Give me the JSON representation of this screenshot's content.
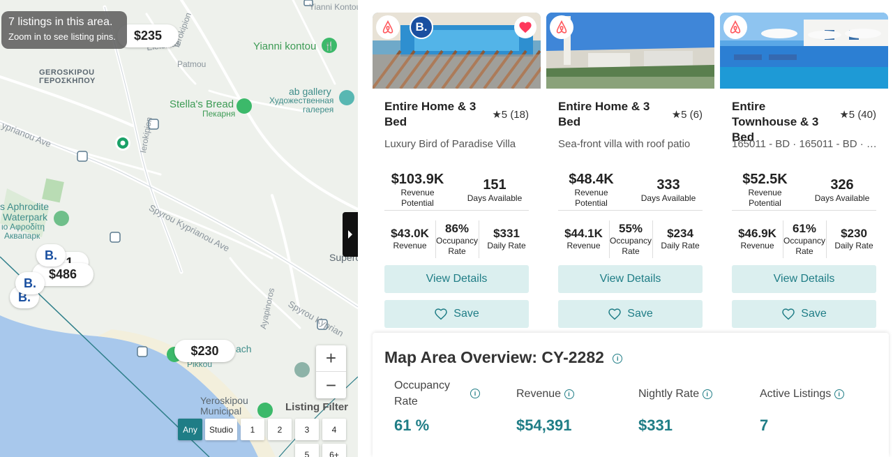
{
  "map": {
    "banner": {
      "line1": "7 listings in this area.",
      "line2": "Zoom in to see listing pins."
    },
    "labels": {
      "yianni_konto_top": "Yianni Kontou",
      "yianni_kontou": "Yianni kontou",
      "geroskipou_1": "GEROSKIPOU",
      "geroskipou_2": "ΓΕΡΟΣΚΗΠΟΥ",
      "elefsinas": "Elefsinas",
      "patmou": "Patmou",
      "ierokipion_1": "Ierokipion",
      "ierokipion_2": "Ierokipion",
      "stellas_bread_1": "Stella's Bread",
      "stellas_bread_2": "Пекарня",
      "ab_gallery_1": "ab gallery",
      "ab_gallery_2": "Художественная",
      "ab_gallery_3": "галерея",
      "kyprianou_ave": "yprianou Ave",
      "aphrodite_1": "s Aphrodite",
      "aphrodite_2": "Waterpark",
      "aphrodite_3": "ιο Αφροδίτη",
      "aphrodite_4": "Аквапарк",
      "spyrou_1": "Spyrou Kyprianou Ave",
      "spyrou_2": "Spyrou Kyprian",
      "supercos": "Supercos",
      "ayapinoros": "Ayapinoros",
      "beach": "ach",
      "pikkou": "Pikkou",
      "yeroskipou_mun_1": "Yeroskipou",
      "yeroskipou_mun_2": "Municipal"
    },
    "price_pins": {
      "pin1": "$235",
      "pin2": "$486",
      "pin3": "$230",
      "pin4": "1"
    },
    "booking_pin_label": "B.",
    "zoom": {
      "plus": "+",
      "minus": "−"
    },
    "filter": {
      "title": "Listing Filter",
      "options": [
        "Any",
        "Studio",
        "1",
        "2",
        "3",
        "4",
        "5",
        "6+"
      ],
      "selected": "Any"
    }
  },
  "listings": [
    {
      "title": "Entire Home & 3 Bed",
      "rating": "★5 (18)",
      "subtitle": "Luxury Bird of Paradise Villa",
      "revenue_potential": "$103.9K",
      "revenue_potential_label": "Revenue Potential",
      "days_available": "151",
      "days_available_label": "Days Available",
      "revenue": "$43.0K",
      "revenue_label": "Revenue",
      "occupancy": "86%",
      "occupancy_label": "Occupancy Rate",
      "daily_rate": "$331",
      "daily_rate_label": "Daily Rate",
      "view_label": "View Details",
      "save_label": "Save",
      "favorited": true,
      "platforms": [
        "airbnb-logo",
        "booking-logo"
      ]
    },
    {
      "title": "Entire Home & 3 Bed",
      "rating": "★5 (6)",
      "subtitle": "Sea-front villa with roof patio",
      "revenue_potential": "$48.4K",
      "revenue_potential_label": "Revenue Potential",
      "days_available": "333",
      "days_available_label": "Days Available",
      "revenue": "$44.1K",
      "revenue_label": "Revenue",
      "occupancy": "55%",
      "occupancy_label": "Occupancy Rate",
      "daily_rate": "$234",
      "daily_rate_label": "Daily Rate",
      "view_label": "View Details",
      "save_label": "Save",
      "favorited": false,
      "platforms": [
        "airbnb-logo"
      ]
    },
    {
      "title": "Entire Townhouse & 3 Bed",
      "rating": "★5 (40)",
      "subtitle": "165011 - BD · 165011 - BD · …",
      "revenue_potential": "$52.5K",
      "revenue_potential_label": "Revenue Potential",
      "days_available": "326",
      "days_available_label": "Days Available",
      "revenue": "$46.9K",
      "revenue_label": "Revenue",
      "occupancy": "61%",
      "occupancy_label": "Occupancy Rate",
      "daily_rate": "$230",
      "daily_rate_label": "Daily Rate",
      "view_label": "View Details",
      "save_label": "Save",
      "favorited": false,
      "platforms": [
        "airbnb-logo"
      ]
    }
  ],
  "overview": {
    "title": "Map Area Overview: CY-2282",
    "metrics": [
      {
        "label": "Occupancy Rate",
        "value": "61 %"
      },
      {
        "label": "Revenue",
        "value": "$54,391"
      },
      {
        "label": "Nightly Rate",
        "value": "$331"
      },
      {
        "label": "Active Listings",
        "value": "7"
      }
    ]
  },
  "colors": {
    "accent": "#1f7d86",
    "accent_light": "#dbefef",
    "airbnb": "#ff5a5f",
    "booking": "#1a4fa0",
    "water": "#a8c8ec"
  }
}
